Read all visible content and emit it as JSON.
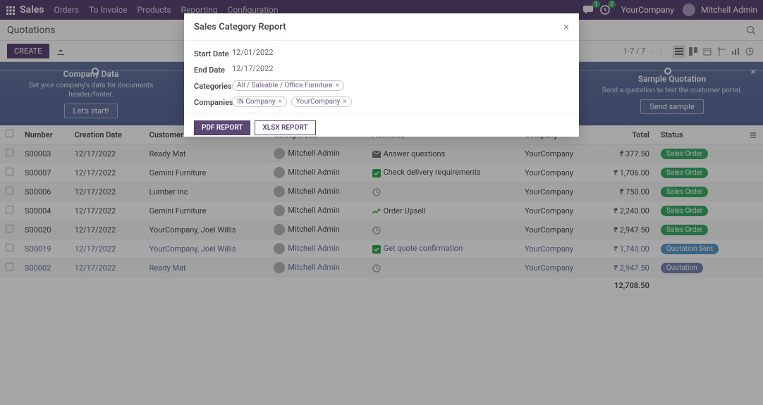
{
  "topnav": {
    "app": "Sales",
    "menu": [
      "Orders",
      "To Invoice",
      "Products",
      "Reporting",
      "Configuration"
    ],
    "chat_count": "1",
    "activity_count": "2",
    "company": "YourCompany",
    "user": "Mitchell Admin"
  },
  "subbar": {
    "title": "Quotations"
  },
  "actions": {
    "create": "CREATE",
    "pager": "1-7 / 7"
  },
  "banner": {
    "left": {
      "title": "Company Data",
      "desc": "Set your company's data for documents header/footer.",
      "btn": "Let's start!"
    },
    "right": {
      "title": "Sample Quotation",
      "desc": "Send a quotation to test the customer portal.",
      "btn": "Send sample"
    }
  },
  "table": {
    "headers": [
      "Number",
      "Creation Date",
      "Customer",
      "Salesperson",
      "Activities",
      "Company",
      "Total",
      "Status"
    ],
    "rows": [
      {
        "num": "S00003",
        "date": "12/17/2022",
        "cust": "Ready Mat",
        "sp": "Mitchell Admin",
        "act": "Answer questions",
        "act_ico": "mail",
        "co": "YourCompany",
        "total": "₹ 377.50",
        "status": "Sales Order",
        "sclass": "b-so"
      },
      {
        "num": "S00007",
        "date": "12/17/2022",
        "cust": "Gemini Furniture",
        "sp": "Mitchell Admin",
        "act": "Check delivery requirements",
        "act_ico": "check",
        "co": "YourCompany",
        "total": "₹ 1,706.00",
        "status": "Sales Order",
        "sclass": "b-so"
      },
      {
        "num": "S00006",
        "date": "12/17/2022",
        "cust": "Lumber Inc",
        "sp": "Mitchell Admin",
        "act": "",
        "act_ico": "clock",
        "co": "YourCompany",
        "total": "₹ 750.00",
        "status": "Sales Order",
        "sclass": "b-so"
      },
      {
        "num": "S00004",
        "date": "12/17/2022",
        "cust": "Gemini Furniture",
        "sp": "Mitchell Admin",
        "act": "Order Upsell",
        "act_ico": "graph",
        "co": "YourCompany",
        "total": "₹ 2,240.00",
        "status": "Sales Order",
        "sclass": "b-so"
      },
      {
        "num": "S00020",
        "date": "12/17/2022",
        "cust": "YourCompany, Joel Willis",
        "sp": "Mitchell Admin",
        "act": "",
        "act_ico": "clock",
        "co": "YourCompany",
        "total": "₹ 2,947.50",
        "status": "Sales Order",
        "sclass": "b-so"
      },
      {
        "num": "S00019",
        "date": "12/17/2022",
        "cust": "YourCompany, Joel Willis",
        "sp": "Mitchell Admin",
        "act": "Get quote confirmation",
        "act_ico": "check",
        "co": "YourCompany",
        "total": "₹ 1,740.00",
        "status": "Quotation Sent",
        "sclass": "b-qs",
        "link": true
      },
      {
        "num": "S00002",
        "date": "12/17/2022",
        "cust": "Ready Mat",
        "sp": "Mitchell Admin",
        "act": "",
        "act_ico": "clock",
        "co": "YourCompany",
        "total": "₹ 2,947.50",
        "status": "Quotation",
        "sclass": "b-q",
        "link": true
      }
    ],
    "footer_total": "12,708.50"
  },
  "modal": {
    "title": "Sales Category Report",
    "start_date_label": "Start Date",
    "start_date": "12/01/2022",
    "end_date_label": "End Date",
    "end_date": "12/17/2022",
    "categories_label": "Categories",
    "categories": [
      "All / Saleable / Office Furniture"
    ],
    "companies_label": "Companies",
    "companies": [
      "IN Company",
      "YourCompany"
    ],
    "pdf_btn": "PDF REPORT",
    "xlsx_btn": "XLSX REPORT"
  }
}
